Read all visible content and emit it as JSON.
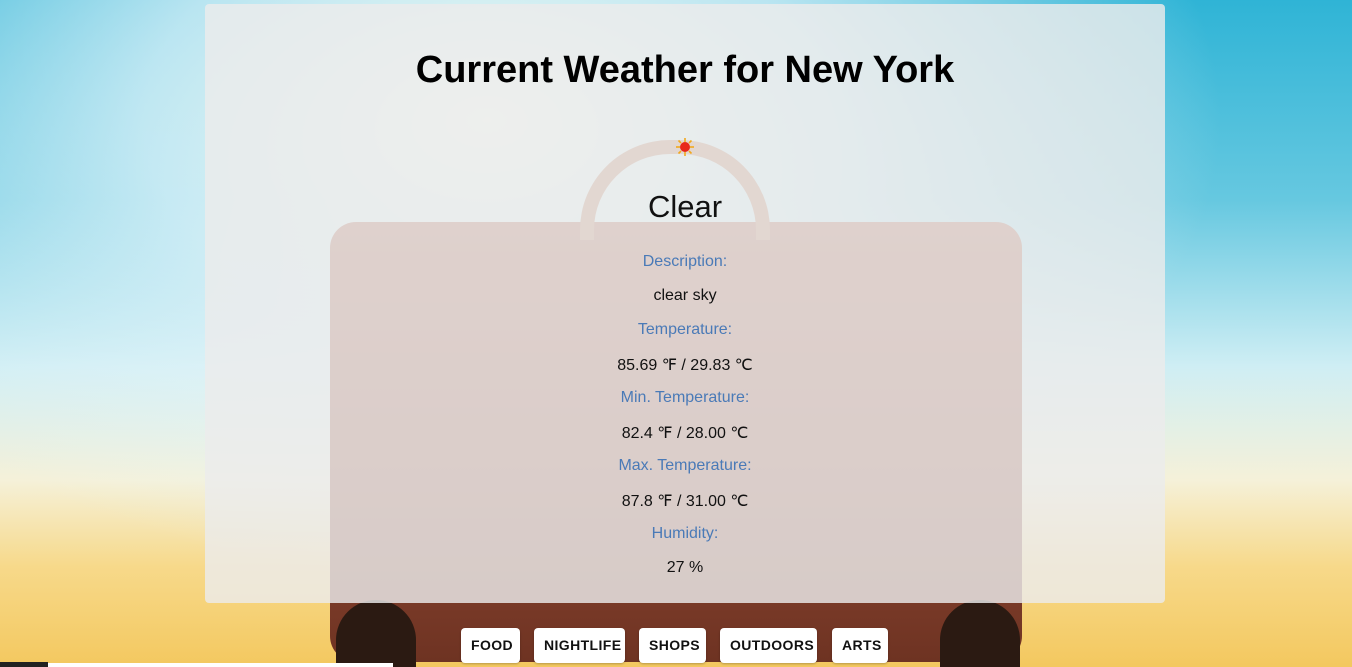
{
  "page": {
    "title": "Current Weather for New York"
  },
  "weather": {
    "icon": "sun-icon",
    "condition": "Clear",
    "fields": [
      {
        "label": "Description:",
        "value": "clear sky"
      },
      {
        "label": "Temperature:",
        "value": "85.69 ℉ / 29.83 ℃"
      },
      {
        "label": "Min. Temperature:",
        "value": "82.4 ℉ / 28.00 ℃"
      },
      {
        "label": "Max. Temperature:",
        "value": "87.8 ℉ / 31.00 ℃"
      },
      {
        "label": "Humidity:",
        "value": "27 %"
      }
    ]
  },
  "nav": {
    "items": [
      "FOOD",
      "NIGHTLIFE",
      "SHOPS",
      "OUTDOORS",
      "ARTS"
    ]
  },
  "colors": {
    "label": "#4a7ab7",
    "card": "#ececec",
    "sun": "#e8281a"
  }
}
